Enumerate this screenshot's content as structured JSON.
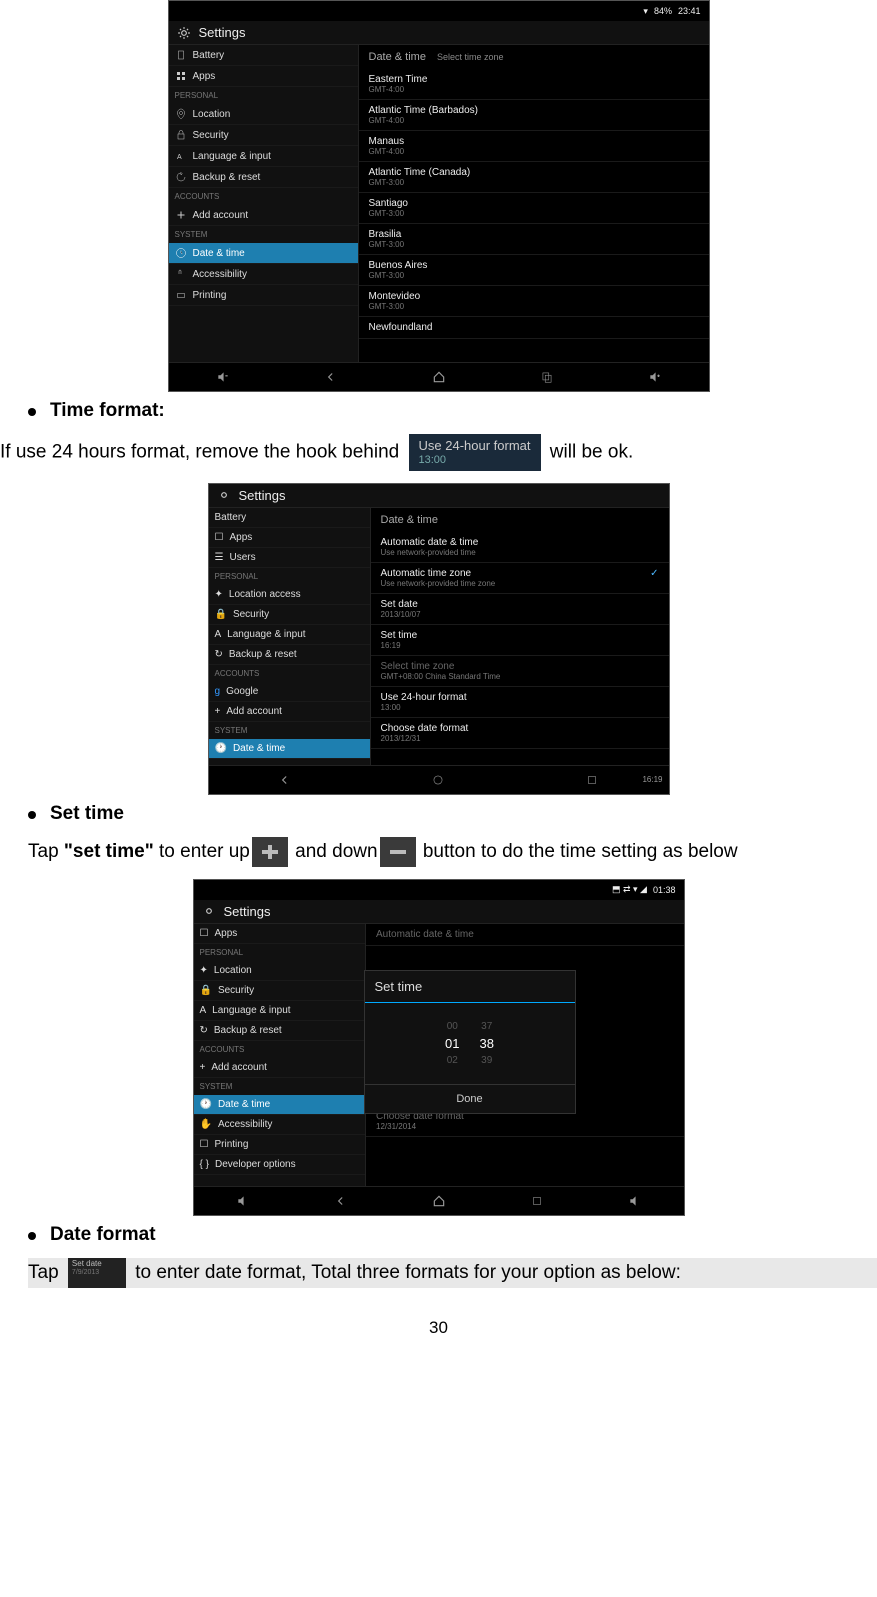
{
  "page_number": "30",
  "ss1": {
    "status_time": "23:41",
    "status_battery": "84%",
    "title": "Settings",
    "sidebar_headers": {
      "personal": "PERSONAL",
      "accounts": "ACCOUNTS",
      "system": "SYSTEM"
    },
    "sidebar": {
      "battery": "Battery",
      "apps": "Apps",
      "location": "Location",
      "security": "Security",
      "lang": "Language & input",
      "backup": "Backup & reset",
      "add_account": "Add account",
      "date_time": "Date & time",
      "accessibility": "Accessibility",
      "printing": "Printing"
    },
    "breadcrumb": "Date & time",
    "breadcrumb_sub": "Select time zone",
    "items": [
      {
        "t": "Eastern Time",
        "s": "GMT-4:00"
      },
      {
        "t": "Atlantic Time (Barbados)",
        "s": "GMT-4:00"
      },
      {
        "t": "Manaus",
        "s": "GMT-4:00"
      },
      {
        "t": "Atlantic Time (Canada)",
        "s": "GMT-3:00"
      },
      {
        "t": "Santiago",
        "s": "GMT-3:00"
      },
      {
        "t": "Brasilia",
        "s": "GMT-3:00"
      },
      {
        "t": "Buenos Aires",
        "s": "GMT-3:00"
      },
      {
        "t": "Montevideo",
        "s": "GMT-3:00"
      },
      {
        "t": "Newfoundland",
        "s": ""
      }
    ]
  },
  "sec_time_format": {
    "heading": "Time format:",
    "text_before": "If use 24 hours format, remove the hook behind",
    "chip_title": "Use 24-hour format",
    "chip_sub": "13:00",
    "text_after": "will be ok."
  },
  "ss2": {
    "title": "Settings",
    "status_right": "16:19",
    "sidebar": {
      "battery": "Battery",
      "apps": "Apps",
      "users": "Users",
      "location": "Location access",
      "security": "Security",
      "lang": "Language & input",
      "backup": "Backup & reset",
      "google": "Google",
      "add_account": "Add account",
      "date_time": "Date & time"
    },
    "sidebar_headers": {
      "personal": "PERSONAL",
      "accounts": "ACCOUNTS",
      "system": "SYSTEM"
    },
    "breadcrumb": "Date & time",
    "items": [
      {
        "t": "Automatic date & time",
        "s": "Use network-provided time"
      },
      {
        "t": "Automatic time zone",
        "s": "Use network-provided time zone",
        "chk": true
      },
      {
        "t": "Set date",
        "s": "2013/10/07"
      },
      {
        "t": "Set time",
        "s": "16:19"
      },
      {
        "t": "Select time zone",
        "s": "GMT+08:00 China Standard Time",
        "dim": true
      },
      {
        "t": "Use 24-hour format",
        "s": "13:00"
      },
      {
        "t": "Choose date format",
        "s": "2013/12/31"
      }
    ]
  },
  "sec_set_time": {
    "heading": "Set time",
    "text_a": "Tap ",
    "bold": "\"set time\"",
    "text_b": " to enter up",
    "text_c": " and down",
    "text_d": " button to do the time setting as below"
  },
  "ss3": {
    "title": "Settings",
    "status_time": "01:38",
    "sidebar": {
      "apps": "Apps",
      "location": "Location",
      "security": "Security",
      "lang": "Language & input",
      "backup": "Backup & reset",
      "add_account": "Add account",
      "date_time": "Date & time",
      "accessibility": "Accessibility",
      "printing": "Printing",
      "dev": "Developer options"
    },
    "sidebar_headers": {
      "personal": "PERSONAL",
      "accounts": "ACCOUNTS",
      "system": "SYSTEM"
    },
    "main_bg": {
      "auto": "Automatic date & time",
      "cdf": "Choose date format",
      "cdf_sub": "12/31/2014"
    },
    "dialog": {
      "title": "Set time",
      "h_up": "00",
      "h": "01",
      "h_dn": "02",
      "m_up": "37",
      "m": "38",
      "m_dn": "39",
      "done": "Done"
    }
  },
  "sec_date_format": {
    "heading": "Date format",
    "text_a": "Tap ",
    "chip_t": "Set date",
    "chip_s": "7/9/2013",
    "text_b": " to enter date format, Total three formats for your option as below:"
  }
}
